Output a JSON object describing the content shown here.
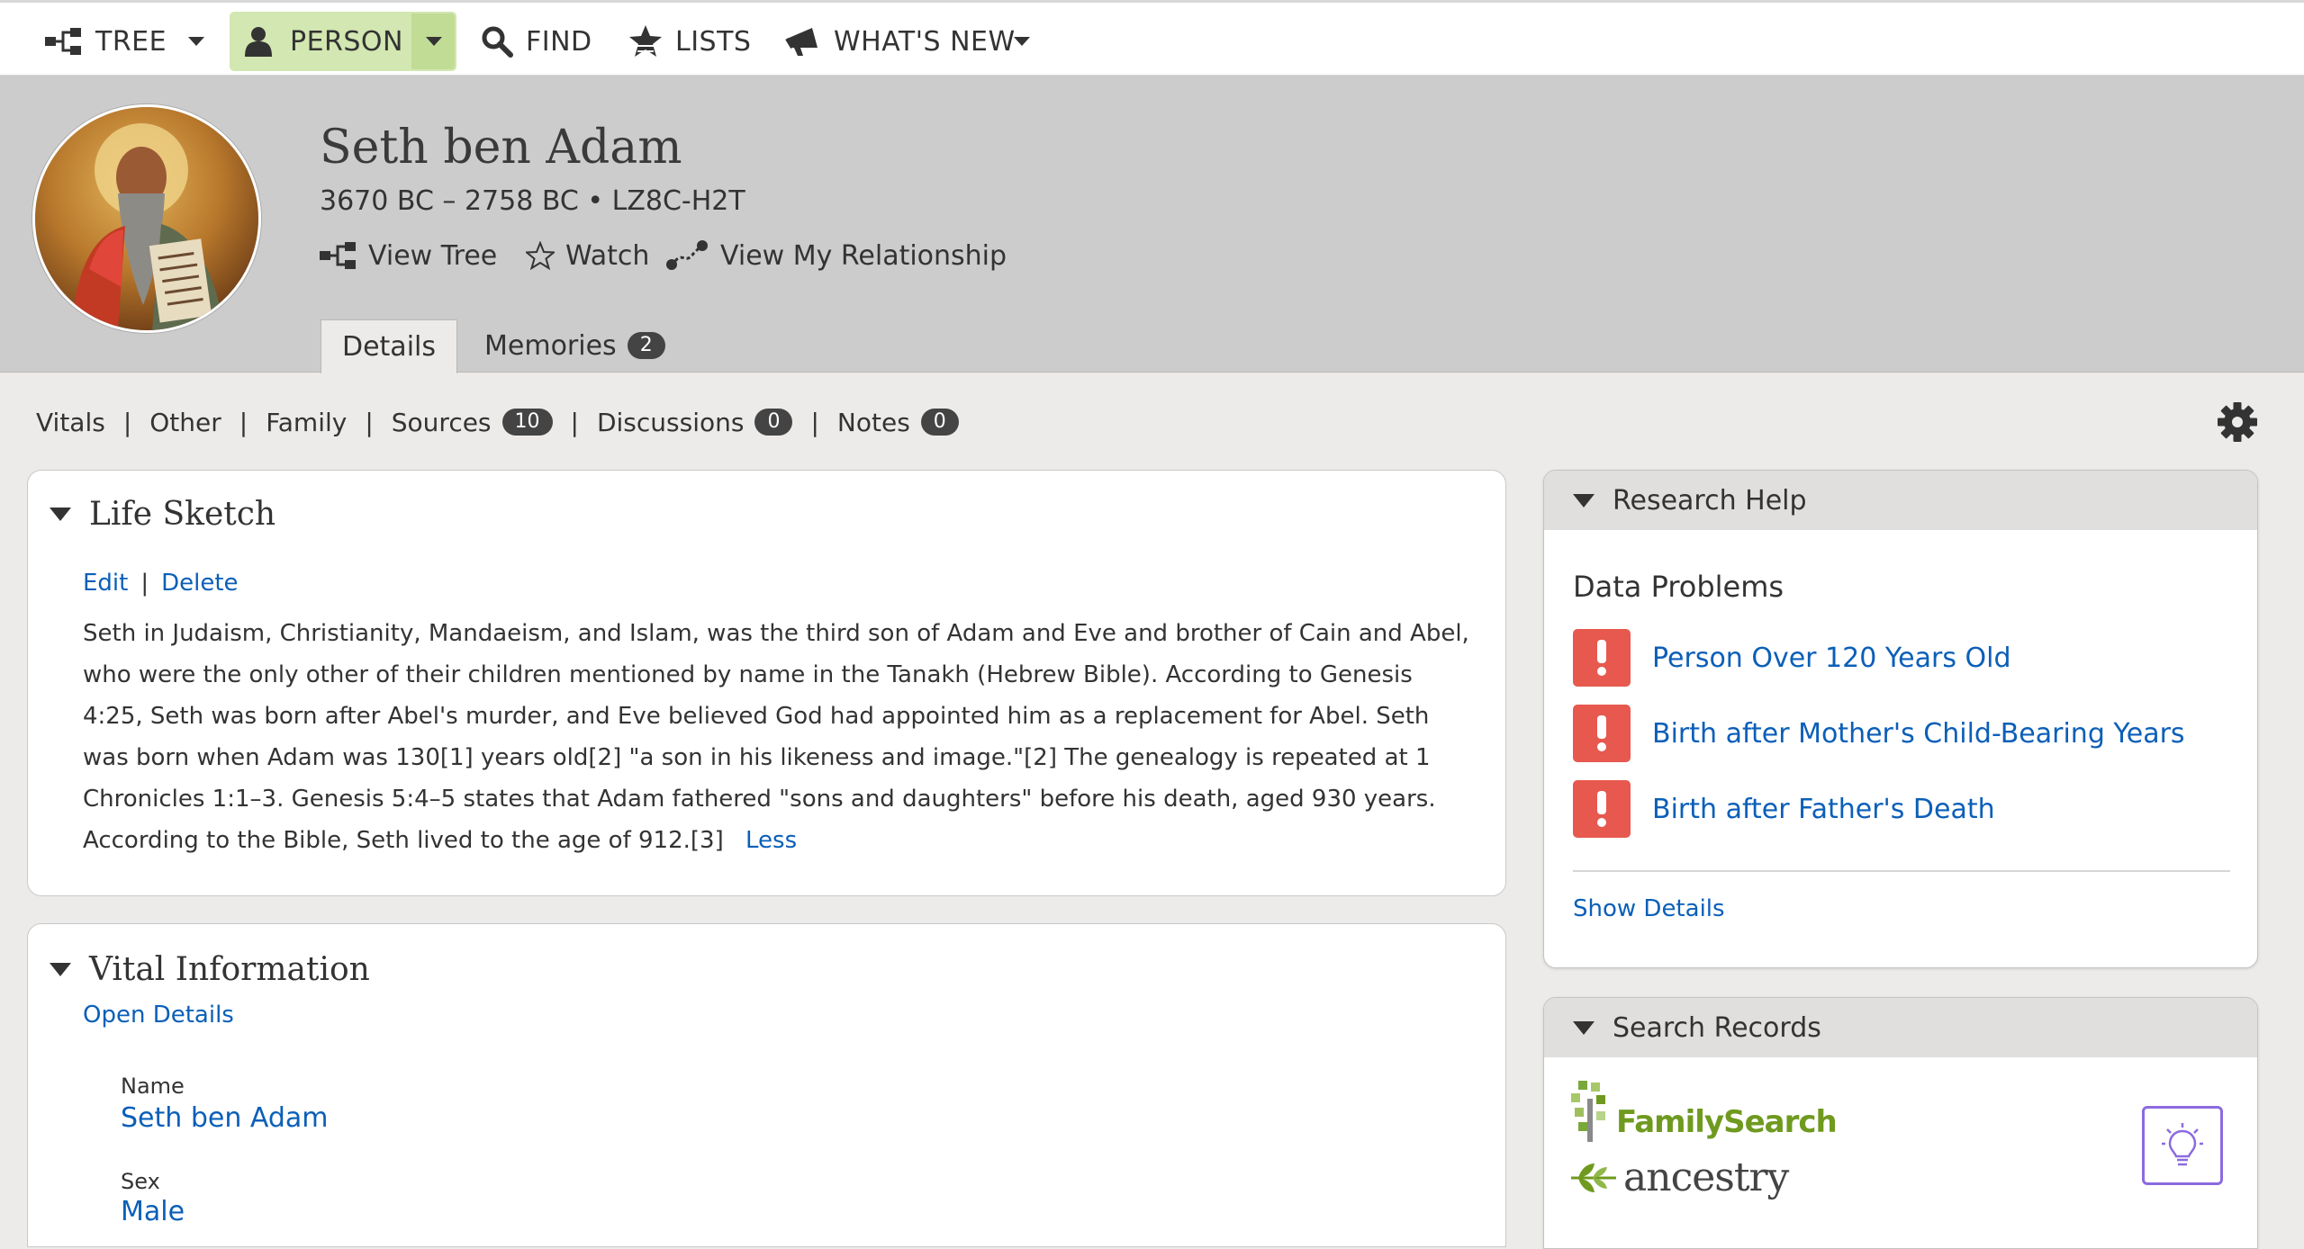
{
  "nav": {
    "tree": "TREE",
    "person": "PERSON",
    "find": "FIND",
    "lists": "LISTS",
    "whats_new": "WHAT'S NEW"
  },
  "person": {
    "name": "Seth ben Adam",
    "meta": "3670 BC – 2758 BC • LZ8C-H2T",
    "actions": {
      "view_tree": "View Tree",
      "watch": "Watch",
      "view_relationship": "View My Relationship"
    },
    "tabs": {
      "details": "Details",
      "memories": "Memories",
      "memories_count": "2"
    }
  },
  "subnav": {
    "vitals": "Vitals",
    "other": "Other",
    "family": "Family",
    "sources": "Sources",
    "sources_count": "10",
    "discussions": "Discussions",
    "discussions_count": "0",
    "notes": "Notes",
    "notes_count": "0",
    "separator": "|"
  },
  "life_sketch": {
    "title": "Life Sketch",
    "edit": "Edit",
    "delete": "Delete",
    "text": "Seth in Judaism, Christianity, Mandaeism, and Islam, was the third son of Adam and Eve and brother of Cain and Abel, who were the only other of their children mentioned by name in the Tanakh (Hebrew Bible). According to Genesis 4:25, Seth was born after Abel's murder, and Eve believed God had appointed him as a replacement for Abel. Seth was born when Adam was 130[1] years old[2] \"a son in his likeness and image.\"[2] The genealogy is repeated at 1 Chronicles 1:1–3. Genesis 5:4–5 states that Adam fathered \"sons and daughters\" before his death, aged 930 years. According to the Bible, Seth lived to the age of 912.[3]",
    "less": "Less"
  },
  "vital_info": {
    "title": "Vital Information",
    "open_details": "Open Details",
    "name_label": "Name",
    "name_value": "Seth ben Adam",
    "sex_label": "Sex",
    "sex_value": "Male"
  },
  "research_help": {
    "title": "Research Help",
    "data_problems": "Data Problems",
    "problems": [
      "Person Over 120 Years Old",
      "Birth after Mother's Child-Bearing Years",
      "Birth after Father's Death"
    ],
    "show_details": "Show Details"
  },
  "search_records": {
    "title": "Search Records",
    "familysearch": "FamilySearch",
    "ancestry": "ancestry"
  },
  "colors": {
    "link": "#0b5fb8",
    "person_tab_bg": "#d2e7b1",
    "header_bg": "#cccccc",
    "alert": "#e7584e",
    "familysearch_green": "#6f9a1f",
    "tip_purple": "#8c6be0"
  }
}
